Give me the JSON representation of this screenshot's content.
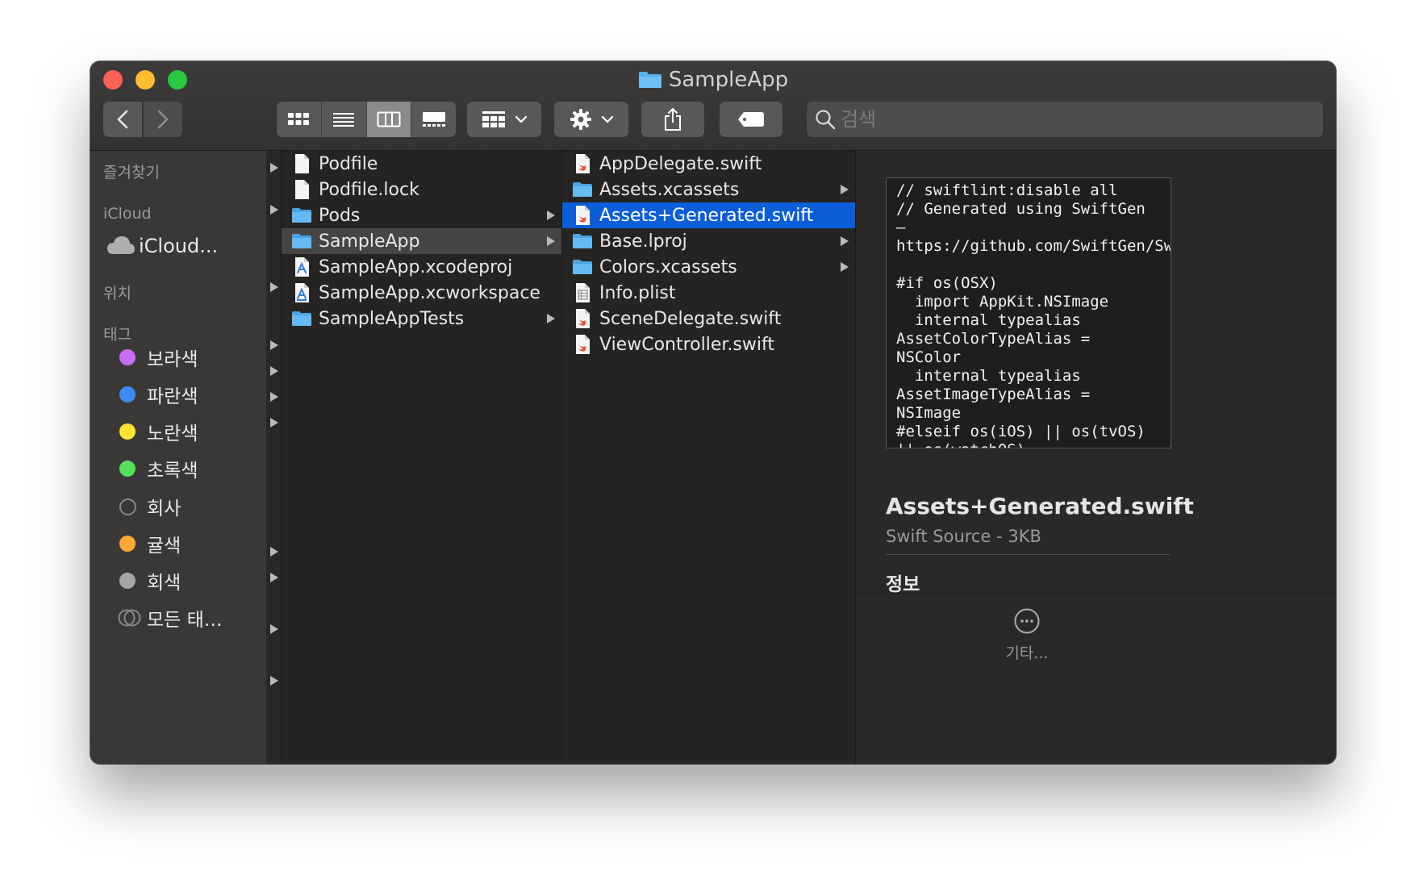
{
  "window": {
    "title": "SampleApp"
  },
  "toolbar": {
    "search_placeholder": "검색"
  },
  "sidebar": {
    "sections": [
      {
        "label": "즐겨찾기"
      },
      {
        "label": "iCloud"
      },
      {
        "label": "위치"
      },
      {
        "label": "태그"
      }
    ],
    "icloud_item": "iCloud...",
    "tags": [
      {
        "label": "보라색",
        "color": "#c86ff1"
      },
      {
        "label": "파란색",
        "color": "#3d8cf5"
      },
      {
        "label": "노란색",
        "color": "#fde332"
      },
      {
        "label": "초록색",
        "color": "#53e05a"
      },
      {
        "label": "회사",
        "color": ""
      },
      {
        "label": "귤색",
        "color": "#fda73a"
      },
      {
        "label": "회색",
        "color": "#a6a5a4"
      },
      {
        "label": "모든 태…",
        "color": ""
      }
    ]
  },
  "column1": {
    "items": [
      {
        "name": "Podfile",
        "icon": "file-icon"
      },
      {
        "name": "Podfile.lock",
        "icon": "file-icon"
      },
      {
        "name": "Pods",
        "icon": "folder-icon"
      },
      {
        "name": "SampleApp",
        "icon": "folder-icon",
        "selected": true
      },
      {
        "name": "SampleApp.xcodeproj",
        "icon": "xcode-project-icon"
      },
      {
        "name": "SampleApp.xcworkspace",
        "icon": "xcode-workspace-icon"
      },
      {
        "name": "SampleAppTests",
        "icon": "folder-icon"
      }
    ]
  },
  "column2": {
    "items": [
      {
        "name": "AppDelegate.swift",
        "icon": "swift-file-icon"
      },
      {
        "name": "Assets.xcassets",
        "icon": "folder-icon"
      },
      {
        "name": "Assets+Generated.swift",
        "icon": "swift-file-icon",
        "selected": true
      },
      {
        "name": "Base.lproj",
        "icon": "folder-icon"
      },
      {
        "name": "Colors.xcassets",
        "icon": "folder-icon"
      },
      {
        "name": "Info.plist",
        "icon": "plist-file-icon"
      },
      {
        "name": "SceneDelegate.swift",
        "icon": "swift-file-icon"
      },
      {
        "name": "ViewController.swift",
        "icon": "swift-file-icon"
      }
    ]
  },
  "preview": {
    "code": "// swiftlint:disable all\n// Generated using SwiftGen — https://github.com/SwiftGen/SwiftGen\n\n#if os(OSX)\n  import AppKit.NSImage\n  internal typealias AssetColorTypeAlias = NSColor\n  internal typealias AssetImageTypeAlias = NSImage\n#elseif os(iOS) || os(tvOS) || os(watchOS)",
    "file_name": "Assets+Generated.swift",
    "file_kind": "Swift Source - 3KB",
    "info_label": "정보",
    "more_label": "기타..."
  },
  "colors": {
    "selection_blue": "#0b5ed7",
    "folder_blue": "#5ab0ec"
  }
}
